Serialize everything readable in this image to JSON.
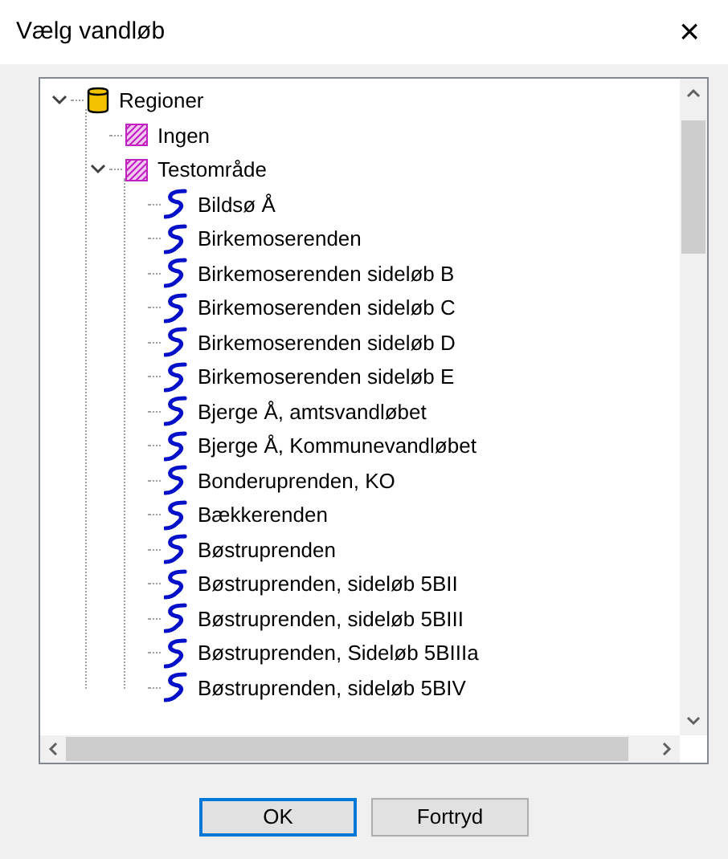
{
  "window": {
    "title": "Vælg vandløb",
    "close": "×"
  },
  "tree": [
    {
      "label": "Regioner",
      "kind": "database",
      "expanded": true,
      "children": [
        {
          "label": "Ingen",
          "kind": "region"
        },
        {
          "label": "Testområde",
          "kind": "region",
          "expanded": true,
          "children": [
            {
              "label": "Bildsø Å",
              "kind": "stream"
            },
            {
              "label": "Birkemoserenden",
              "kind": "stream"
            },
            {
              "label": "Birkemoserenden sideløb B",
              "kind": "stream"
            },
            {
              "label": "Birkemoserenden sideløb C",
              "kind": "stream"
            },
            {
              "label": "Birkemoserenden sideløb D",
              "kind": "stream"
            },
            {
              "label": "Birkemoserenden sideløb E",
              "kind": "stream"
            },
            {
              "label": "Bjerge Å, amtsvandløbet",
              "kind": "stream"
            },
            {
              "label": "Bjerge Å, Kommunevandløbet",
              "kind": "stream"
            },
            {
              "label": "Bonderuprenden, KO",
              "kind": "stream"
            },
            {
              "label": "Bækkerenden",
              "kind": "stream"
            },
            {
              "label": "Bøstruprenden",
              "kind": "stream"
            },
            {
              "label": "Bøstruprenden, sideløb 5BII",
              "kind": "stream"
            },
            {
              "label": "Bøstruprenden, sideløb 5BIII",
              "kind": "stream"
            },
            {
              "label": "Bøstruprenden, Sideløb 5BIIIa",
              "kind": "stream"
            },
            {
              "label": "Bøstruprenden, sideløb 5BIV",
              "kind": "stream"
            }
          ]
        }
      ]
    }
  ],
  "buttons": [
    {
      "label": "OK",
      "default": true
    },
    {
      "label": "Fortryd",
      "default": false
    }
  ]
}
